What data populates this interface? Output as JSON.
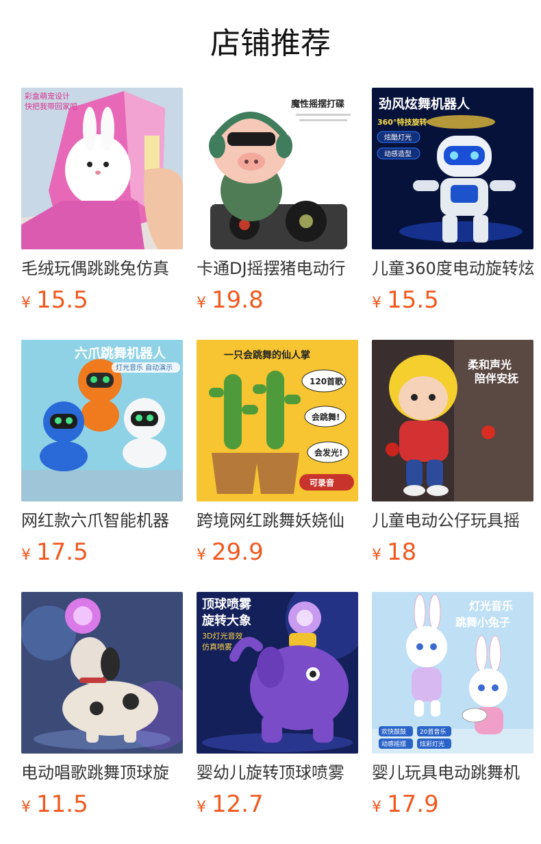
{
  "header": {
    "title": "店铺推荐"
  },
  "currency_symbol": "¥",
  "colors": {
    "price": "#f0581e",
    "title": "#111111",
    "product_name": "#333333"
  },
  "products": [
    {
      "name": "毛绒玩偶跳跳兔仿真",
      "price": "15.5",
      "image": "plush-bunny-toy",
      "image_text": [
        "彩盒萌宠设计",
        "快把我带回家吧"
      ]
    },
    {
      "name": "卡通DJ摇摆猪电动行",
      "price": "19.8",
      "image": "dj-pig-toy",
      "image_text": [
        "魔性摇摆打碟"
      ]
    },
    {
      "name": "儿童360度电动旋转炫",
      "price": "15.5",
      "image": "dancing-robot-toy",
      "image_text": [
        "劲风炫舞机器人",
        "360°特技旋转",
        "炫酷灯光",
        "动感造型"
      ]
    },
    {
      "name": "网红款六爪智能机器",
      "price": "17.5",
      "image": "six-claw-robot-toy",
      "image_text": [
        "六爪跳舞机器人",
        "灯光音乐 自动演示"
      ]
    },
    {
      "name": "跨境网红跳舞妖娆仙",
      "price": "29.9",
      "image": "dancing-cactus-toy",
      "image_text": [
        "一只会跳舞的仙人掌",
        "120首歌",
        "会跳舞!",
        "会发光!",
        "可录音"
      ]
    },
    {
      "name": "儿童电动公仔玩具摇",
      "price": "18",
      "image": "dancing-doll-toy",
      "image_text": [
        "柔和声光",
        "陪伴安抚"
      ]
    },
    {
      "name": "电动唱歌跳舞顶球旋",
      "price": "11.5",
      "image": "ball-spinning-dog-toy",
      "image_text": []
    },
    {
      "name": "婴幼儿旋转顶球喷雾",
      "price": "12.7",
      "image": "spray-elephant-toy",
      "image_text": [
        "顶球喷雾",
        "旋转大象",
        "3D灯光音效",
        "仿真喷雾"
      ]
    },
    {
      "name": "婴儿玩具电动跳舞机",
      "price": "17.9",
      "image": "dancing-rabbit-toy",
      "image_text": [
        "灯光音乐",
        "跳舞小兔子",
        "欢快鼓鼓",
        "20首音乐",
        "动感摇摆",
        "炫彩灯光"
      ]
    }
  ]
}
